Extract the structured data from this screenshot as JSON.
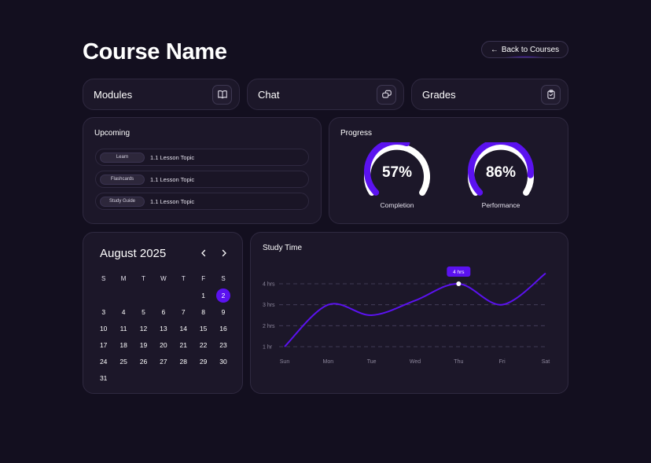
{
  "page": {
    "title": "Course Name",
    "back_label": "Back to Courses"
  },
  "nav": [
    {
      "label": "Modules",
      "icon": "book-icon"
    },
    {
      "label": "Chat",
      "icon": "chat-icon"
    },
    {
      "label": "Grades",
      "icon": "clipboard-check-icon"
    }
  ],
  "upcoming": {
    "title": "Upcoming",
    "items": [
      {
        "tag": "Learn",
        "topic": "1.1 Lesson Topic"
      },
      {
        "tag": "Flashcards",
        "topic": "1.1 Lesson Topic"
      },
      {
        "tag": "Study Guide",
        "topic": "1.1 Lesson Topic"
      }
    ]
  },
  "progress": {
    "title": "Progress",
    "gauges": [
      {
        "value": "57%",
        "fraction": 0.57,
        "label": "Completion"
      },
      {
        "value": "86%",
        "fraction": 0.86,
        "label": "Performance"
      }
    ]
  },
  "calendar": {
    "month": "August 2025",
    "weekdays": [
      "S",
      "M",
      "T",
      "W",
      "T",
      "F",
      "S"
    ],
    "first_weekday_index": 5,
    "days_in_month": 31,
    "selected_day": 2
  },
  "chart_data": {
    "type": "line",
    "title": "Study Time",
    "categories": [
      "Sun",
      "Mon",
      "Tue",
      "Wed",
      "Thu",
      "Fri",
      "Sat"
    ],
    "y_tick_labels": [
      "1 hr",
      "2 hrs",
      "3 hrs",
      "4 hrs"
    ],
    "ylim": [
      1,
      4
    ],
    "values": [
      1.0,
      3.0,
      2.5,
      3.2,
      4.0,
      3.0,
      4.5
    ],
    "tooltip": {
      "category": "Thu",
      "label": "4 hrs"
    },
    "grid": true,
    "line_color": "#5b12f0"
  },
  "colors": {
    "accent": "#5b12f0",
    "background": "#130f1f",
    "card": "#1c1729"
  }
}
